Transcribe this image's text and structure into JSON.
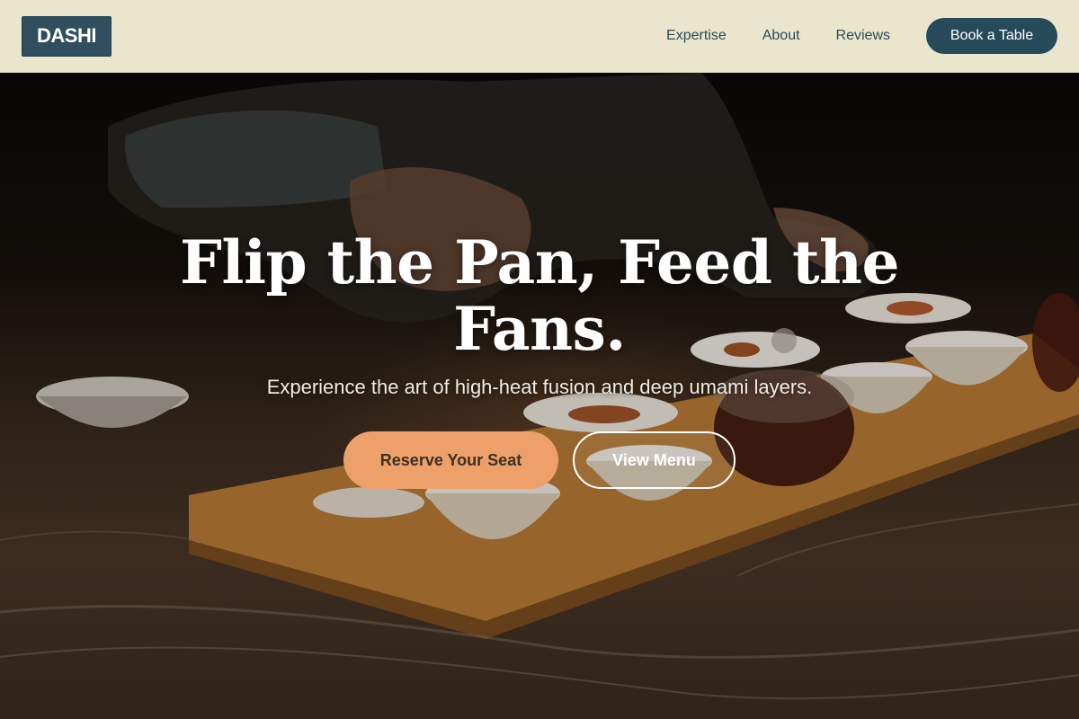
{
  "brand": {
    "logo_text": "DASHI"
  },
  "nav": {
    "links": [
      "Expertise",
      "About",
      "Reviews"
    ],
    "cta_label": "Book a Table"
  },
  "hero": {
    "title": "Flip the Pan, Feed the Fans.",
    "subtitle": "Experience the art of high-heat fusion and deep umami layers.",
    "primary_button": "Reserve Your Seat",
    "secondary_button": "View Menu"
  },
  "colors": {
    "header_bg": "#e9e6cd",
    "logo_bg": "#2f4f5e",
    "nav_text": "#2d4a58",
    "cta_bg": "#274a5b",
    "primary_button_bg": "#eea06a",
    "primary_button_text": "#3b3026"
  }
}
